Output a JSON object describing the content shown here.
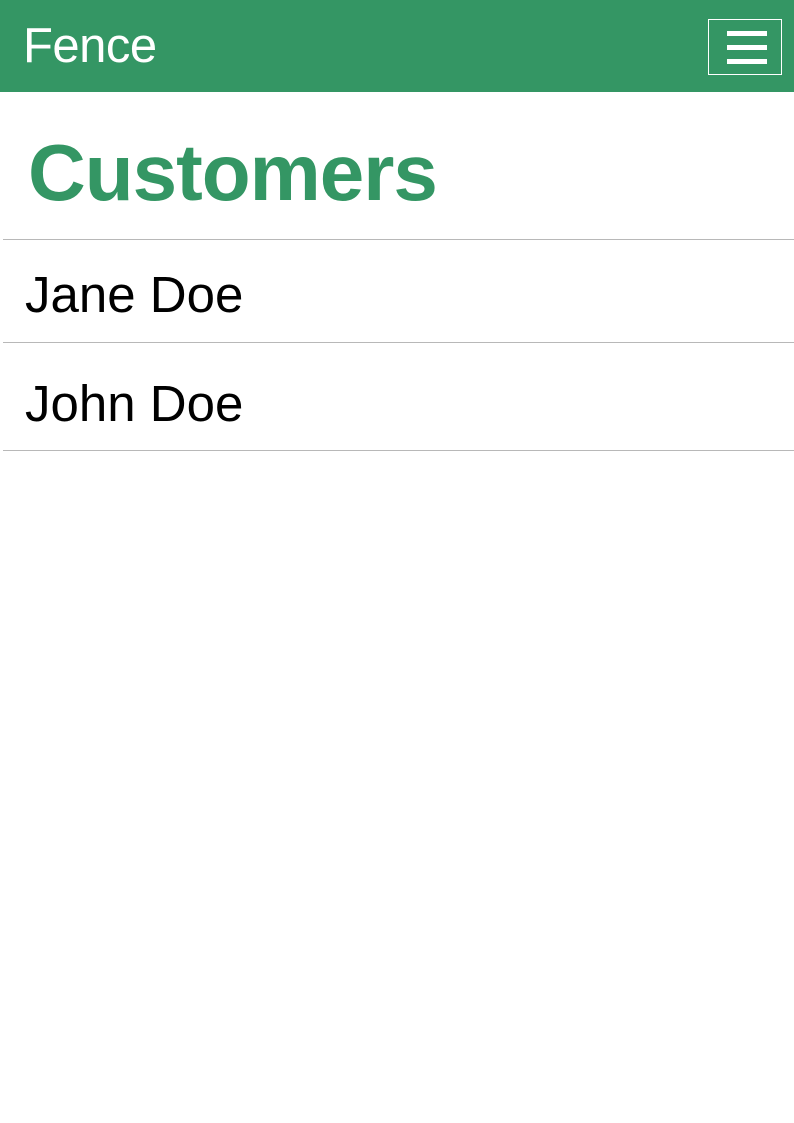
{
  "app_bar": {
    "title": "Fence",
    "menu_icon": "hamburger-menu-icon"
  },
  "main": {
    "title": "Customers",
    "customers": [
      {
        "name": "Jane Doe"
      },
      {
        "name": "John Doe"
      }
    ]
  },
  "colors": {
    "brand_green": "#349664",
    "background": "#ffffff",
    "divider": "#b8b8b8",
    "text": "#000000"
  }
}
